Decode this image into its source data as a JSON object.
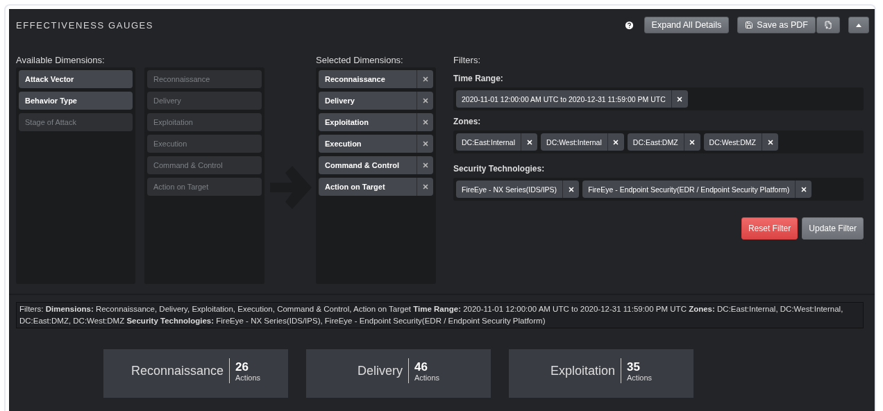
{
  "title": "EFFECTIVENESS GAUGES",
  "toolbar": {
    "help": true,
    "buttons": [
      {
        "kind": "text",
        "label": "Expand All Details"
      },
      {
        "kind": "save",
        "label": "Save as PDF"
      },
      {
        "kind": "file"
      },
      {
        "kind": "collapse"
      }
    ]
  },
  "available": {
    "label": "Available Dimensions:",
    "items": [
      {
        "label": "Attack Vector",
        "selected": false
      },
      {
        "label": "Behavior Type",
        "selected": false
      },
      {
        "label": "Stage of Attack",
        "selected": true
      }
    ]
  },
  "stages": {
    "items": [
      {
        "label": "Reconnaissance",
        "disabled": true
      },
      {
        "label": "Delivery",
        "disabled": true
      },
      {
        "label": "Exploitation",
        "disabled": true
      },
      {
        "label": "Execution",
        "disabled": true
      },
      {
        "label": "Command & Control",
        "disabled": true
      },
      {
        "label": "Action on Target",
        "disabled": true
      }
    ]
  },
  "selected": {
    "label": "Selected Dimensions:",
    "items": [
      "Reconnaissance",
      "Delivery",
      "Exploitation",
      "Execution",
      "Command & Control",
      "Action on Target"
    ]
  },
  "filters": {
    "label": "Filters:",
    "groups": [
      {
        "label": "Time Range:",
        "chips": [
          "2020-11-01 12:00:00 AM UTC to 2020-12-31 11:59:00 PM UTC"
        ]
      },
      {
        "label": "Zones:",
        "chips": [
          "DC:East:Internal",
          "DC:West:Internal",
          "DC:East:DMZ",
          "DC:West:DMZ"
        ]
      },
      {
        "label": "Security Technologies:",
        "chips": [
          "FireEye - NX Series(IDS/IPS)",
          "FireEye - Endpoint Security(EDR / Endpoint Security Platform)"
        ]
      }
    ],
    "buttons": [
      {
        "kind": "danger",
        "label": "Reset Filter"
      },
      {
        "kind": "default",
        "label": "Update Filter"
      }
    ]
  },
  "summary": "Filters: **Dimensions:** Reconnaissance, Delivery, Exploitation, Execution, Command & Control, Action on Target  **Time Range:** 2020-11-01 12:00:00 AM UTC to 2020-12-31 11:59:00 PM UTC  **Zones:** DC:East:Internal, DC:West:Internal, DC:East:DMZ, DC:West:DMZ  **Security Technologies:** FireEye - NX Series(IDS/IPS), FireEye - Endpoint Security(EDR / Endpoint Security Platform)",
  "gauges": [
    {
      "label": "Reconnaissance",
      "count": "26",
      "unit": "Actions"
    },
    {
      "label": "Delivery",
      "count": "46",
      "unit": "Actions"
    },
    {
      "label": "Exploitation",
      "count": "35",
      "unit": "Actions"
    }
  ]
}
